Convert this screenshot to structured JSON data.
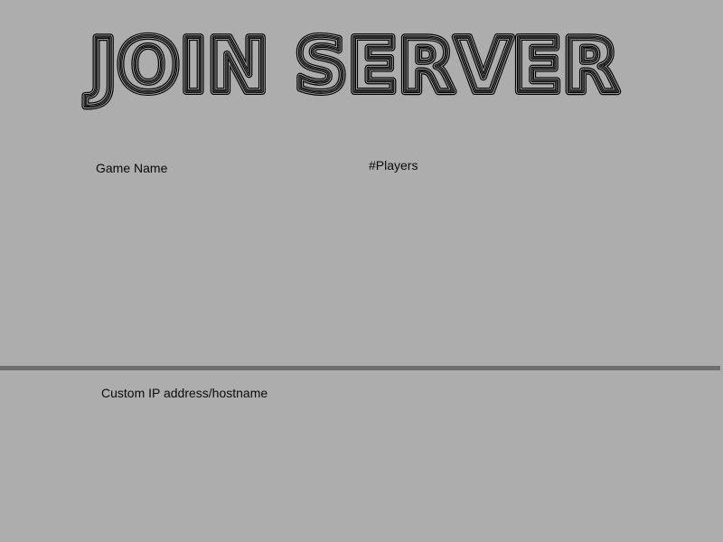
{
  "screen": {
    "title": "JOIN SERVER",
    "background_color": "#adadad",
    "divider_color": "#6f6f6f"
  },
  "server_list": {
    "columns": [
      {
        "label": "Game Name"
      },
      {
        "label": "#Players"
      }
    ],
    "rows": []
  },
  "custom_ip": {
    "label": "Custom IP address/hostname",
    "value": ""
  }
}
